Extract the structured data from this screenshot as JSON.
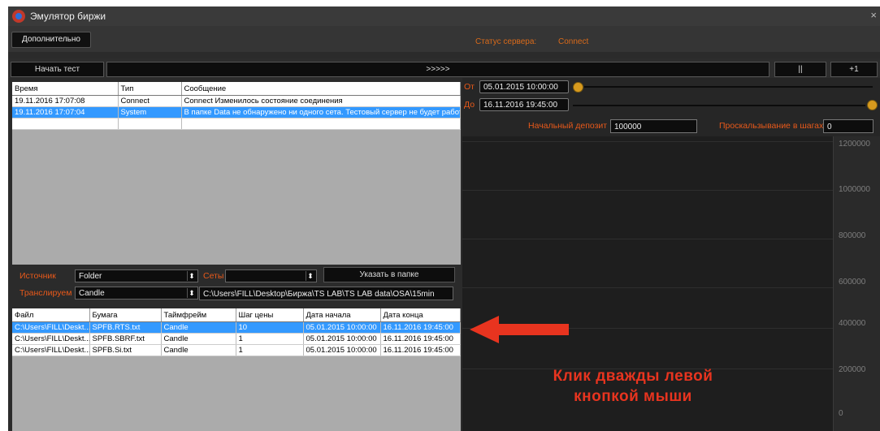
{
  "window": {
    "title": "Эмулятор биржи",
    "close_glyph": "×"
  },
  "toolbar": {
    "extra_label": "Дополнительно",
    "server_status_label": "Статус сервера:",
    "server_status_value": "Connect"
  },
  "test_bar": {
    "start_label": "Начать тест",
    "progress_label": ">>>>>",
    "pause_label": "||",
    "step_label": "+1"
  },
  "log": {
    "columns": [
      "Время",
      "Тип",
      "Сообщение"
    ],
    "rows": [
      {
        "time": "19.11.2016 17:07:08",
        "type": "Connect",
        "message": "Connect Изменилось состояние соединения",
        "selected": false
      },
      {
        "time": "19.11.2016 17:07:04",
        "type": "System",
        "message": "В папке Data не обнаружено ни одного сета. Тестовый сервер не будет работать",
        "selected": true
      }
    ]
  },
  "source": {
    "source_label": "Источник",
    "source_value": "Folder",
    "sets_label": "Сеты",
    "sets_value": "",
    "folder_button": "Указать в папке",
    "translate_label": "Транслируем",
    "translate_value": "Candle",
    "path": "C:\\Users\\FILL\\Desktop\\Биржа\\TS LAB\\TS LAB data\\OSA\\15min"
  },
  "files": {
    "columns": [
      "Файл",
      "Бумага",
      "Таймфрейм",
      "Шаг цены",
      "Дата начала",
      "Дата конца"
    ],
    "rows": [
      {
        "file": "C:\\Users\\FILL\\Deskt...",
        "security": "SPFB.RTS.txt",
        "timeframe": "Candle",
        "step": "10",
        "start": "05.01.2015 10:00:00",
        "end": "16.11.2016 19:45:00",
        "selected": true
      },
      {
        "file": "C:\\Users\\FILL\\Deskt...",
        "security": "SPFB.SBRF.txt",
        "timeframe": "Candle",
        "step": "1",
        "start": "05.01.2015 10:00:00",
        "end": "16.11.2016 19:45:00",
        "selected": false
      },
      {
        "file": "C:\\Users\\FILL\\Deskt...",
        "security": "SPFB.Si.txt",
        "timeframe": "Candle",
        "step": "1",
        "start": "05.01.2015 10:00:00",
        "end": "16.11.2016 19:45:00",
        "selected": false
      }
    ]
  },
  "range": {
    "from_label": "От",
    "from_value": "05.01.2015 10:00:00",
    "to_label": "До",
    "to_value": "16.11.2016 19:45:00",
    "deposit_label": "Начальный депозит",
    "deposit_value": "100000",
    "slippage_label": "Проскальзывание в шагах",
    "slippage_value": "0"
  },
  "chart_axis": {
    "ticks": [
      "1200000",
      "1000000",
      "800000",
      "600000",
      "400000",
      "200000",
      "0"
    ]
  },
  "annotation": {
    "line1": "Клик дважды левой",
    "line2": "кнопкой мыши"
  },
  "colors": {
    "accent_orange": "#e8591a",
    "selection_blue": "#3399ff",
    "annotation_red": "#e8341f",
    "knob": "#d79a1e"
  }
}
